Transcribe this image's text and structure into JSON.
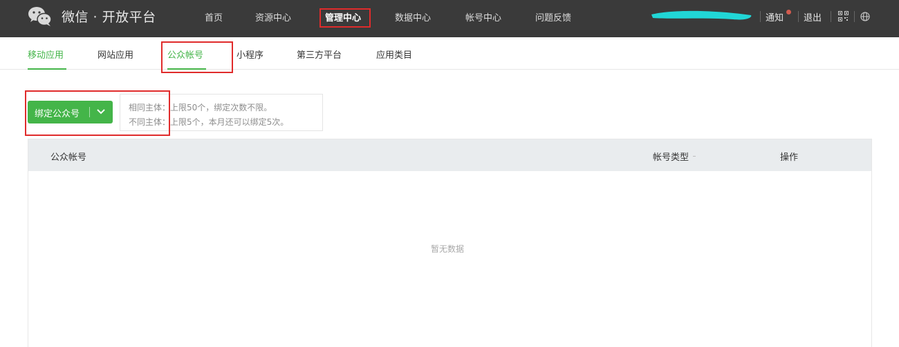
{
  "header": {
    "brand": "微信 · 开放平台",
    "nav": [
      {
        "label": "首页"
      },
      {
        "label": "资源中心"
      },
      {
        "label": "管理中心",
        "active": true
      },
      {
        "label": "数据中心"
      },
      {
        "label": "帐号中心"
      },
      {
        "label": "问题反馈"
      }
    ],
    "notify_label": "通知",
    "logout_label": "退出"
  },
  "subnav": {
    "tabs": [
      {
        "label": "移动应用",
        "active": true
      },
      {
        "label": "网站应用"
      },
      {
        "label": "公众帐号",
        "active": true
      },
      {
        "label": "小程序"
      },
      {
        "label": "第三方平台"
      },
      {
        "label": "应用类目"
      }
    ]
  },
  "bind": {
    "button_label": "绑定公众号",
    "tip_lines": [
      "相同主体：上限50个，绑定次数不限。",
      "不同主体：上限5个，本月还可以绑定5次。"
    ]
  },
  "table": {
    "columns": [
      "公众帐号",
      "帐号类型",
      "操作"
    ],
    "empty_text": "暂无数据"
  },
  "colors": {
    "topbar": "#3a3a3a",
    "accent": "#44b549",
    "highlight": "#e02b2b",
    "notify_dot": "#d35b4e"
  },
  "icons": [
    "wechat-logo-icon",
    "caret-down-icon",
    "qrcode-icon",
    "globe-icon"
  ]
}
